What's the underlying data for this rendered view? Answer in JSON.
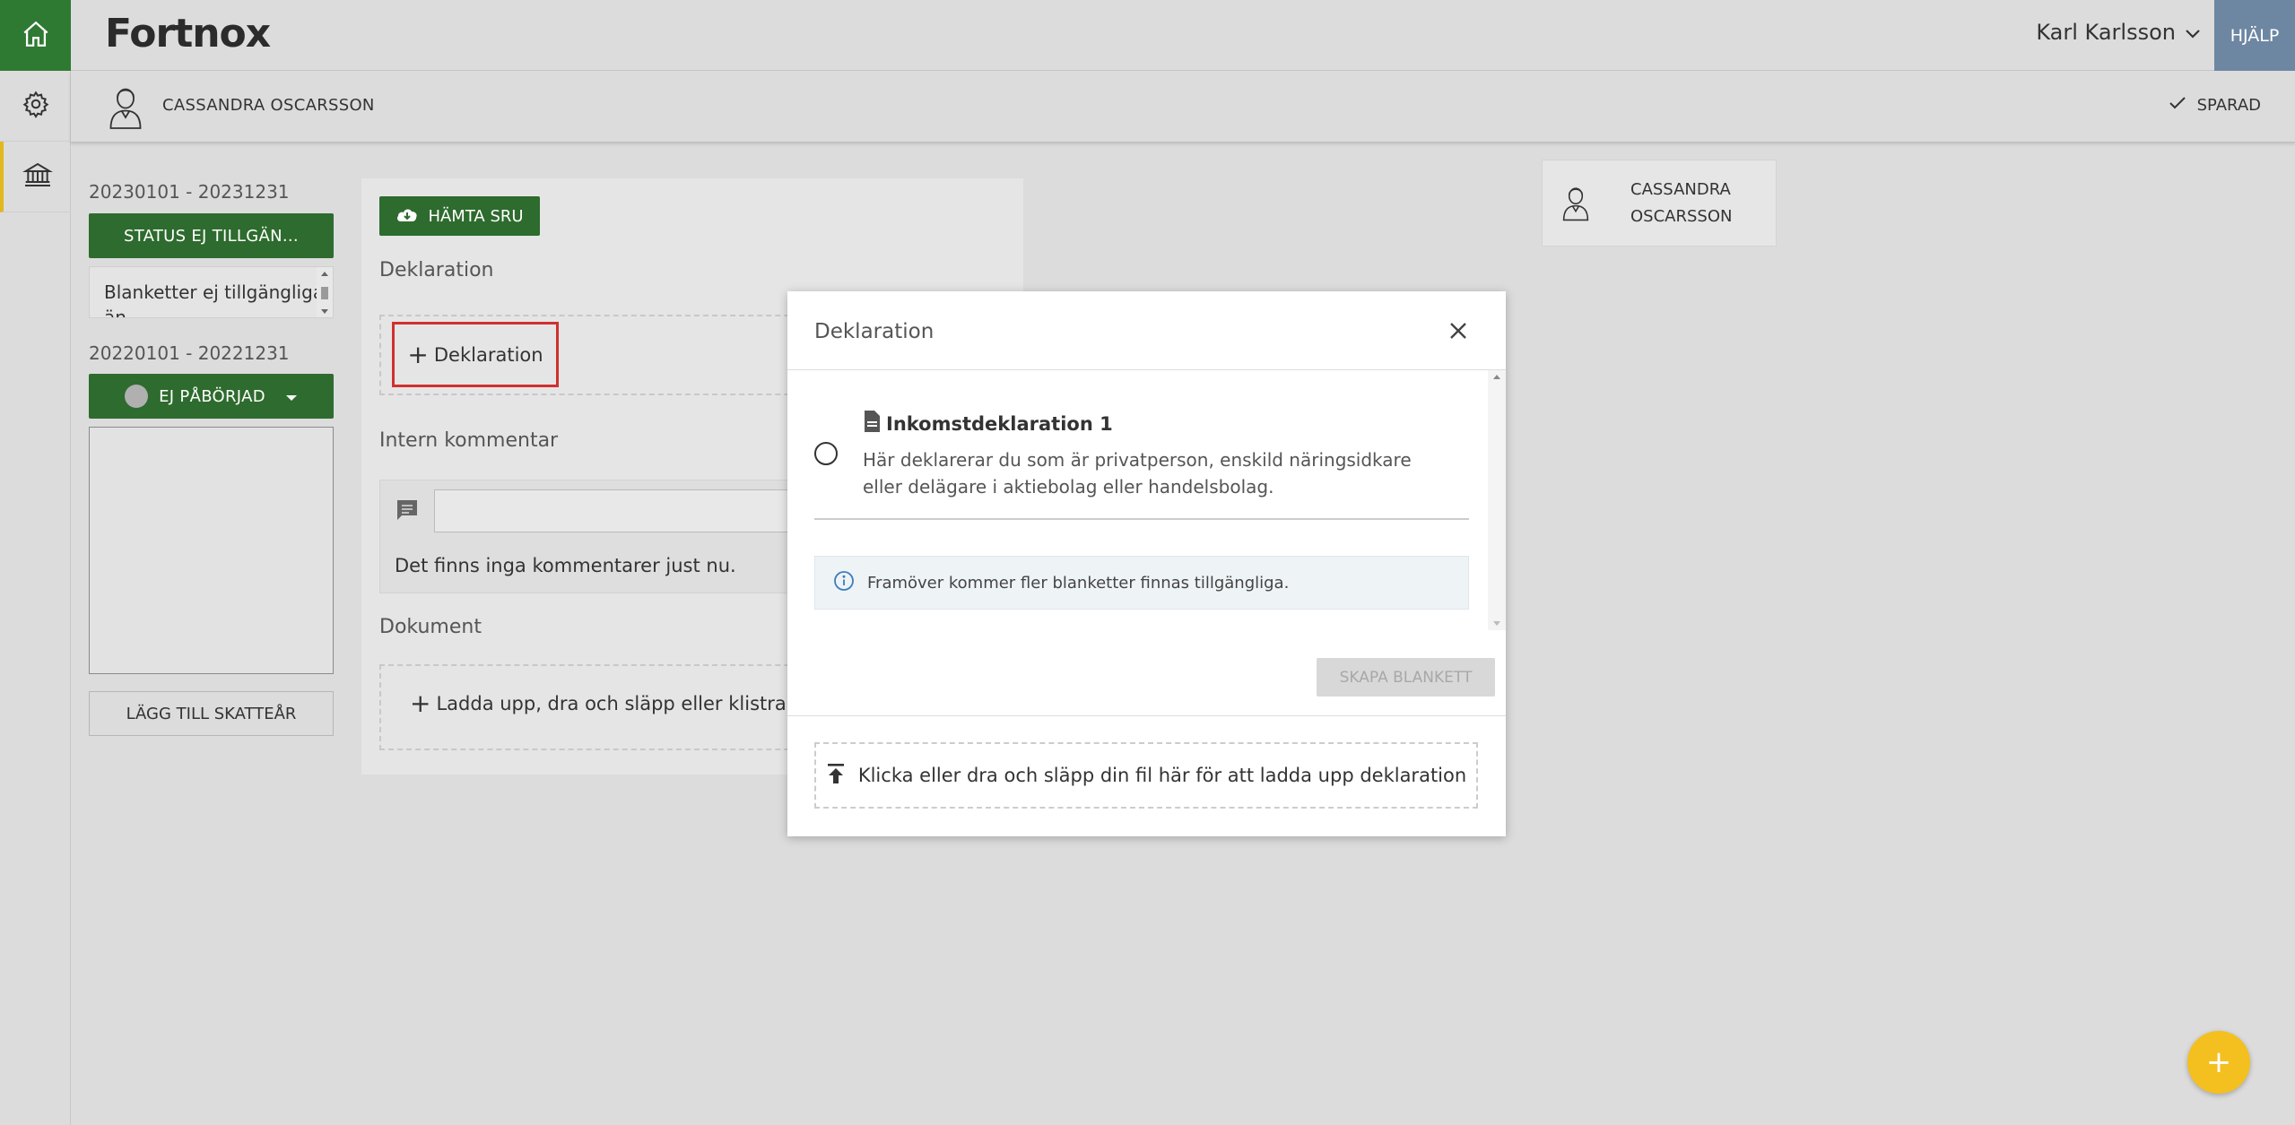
{
  "app": {
    "logo_text": "Fortnox",
    "user_name": "Karl Karlsson",
    "help_label": "HJÄLP",
    "colors": {
      "brand_green": "#2f7a32",
      "button_green": "#2e6b2e",
      "accent_yellow": "#f3c020",
      "help_blue": "#6d87a3",
      "highlight_red": "#d03030"
    }
  },
  "rail": {
    "items": [
      {
        "icon": "home-icon"
      },
      {
        "icon": "gear-icon"
      },
      {
        "icon": "bank-icon"
      }
    ]
  },
  "client_bar": {
    "client_name": "CASSANDRA OSCARSSON",
    "saved_label": "SPARAD"
  },
  "years": [
    {
      "period": "20230101 - 20231231",
      "status_label": "STATUS EJ TILLGÄN...",
      "forms_text": "Blanketter ej tillgängliga än"
    },
    {
      "period": "20220101 - 20221231",
      "status_label": "EJ PÅBÖRJAD"
    }
  ],
  "add_tax_year_label": "LÄGG TILL SKATTEÅR",
  "panel": {
    "sru_button": "HÄMTA SRU",
    "declaration_heading": "Deklaration",
    "add_declaration_label": "Deklaration",
    "comment_heading": "Intern kommentar",
    "no_comments_text": "Det finns inga kommentarer just nu.",
    "documents_heading": "Dokument",
    "upload_text": "Ladda upp, dra och släpp eller klistra in"
  },
  "client_card": {
    "name_line1": "CASSANDRA",
    "name_line2": "OSCARSSON"
  },
  "modal": {
    "title": "Deklaration",
    "option_title": "Inkomstdeklaration 1",
    "option_description": "Här deklarerar du som är privatperson, enskild näringsidkare eller delägare i aktiebolag eller handelsbolag.",
    "info_text": "Framöver kommer fler blanketter finnas tillgängliga.",
    "create_button": "SKAPA BLANKETT",
    "drop_zone_text": "Klicka eller dra och släpp din fil här för att ladda upp deklaration"
  },
  "fab_label": "+"
}
